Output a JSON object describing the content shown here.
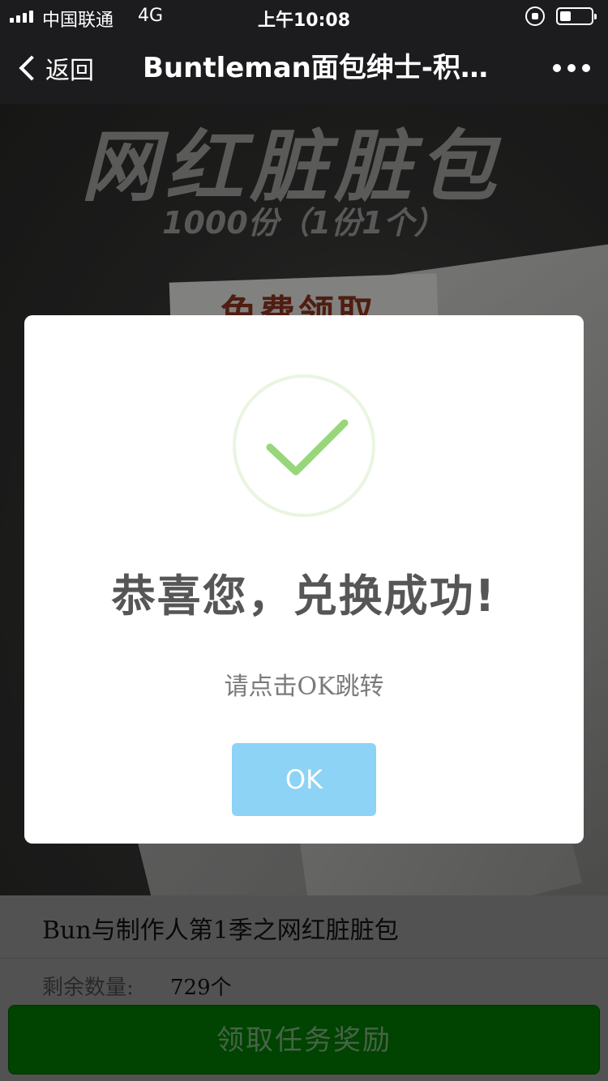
{
  "status_bar": {
    "carrier": "中国联通",
    "network": "4G",
    "time": "上午10:08",
    "battery_level": 0.35
  },
  "nav": {
    "back_label": "返回",
    "title": "Buntleman面包绅士-积…"
  },
  "banner": {
    "title": "网红脏脏包",
    "subtitle": "1000份（1份1个）",
    "tag": "免费领取"
  },
  "item": {
    "name": "Bun与制作人第1季之网红脏脏包",
    "remain_label": "剩余数量:",
    "remain_value": "729个"
  },
  "claim_button_label": "领取任务奖励",
  "modal": {
    "title": "恭喜您，兑换成功!",
    "text": "请点击OK跳转",
    "ok_label": "OK"
  },
  "colors": {
    "modal_ok_button": "#8dd3f5",
    "success_check": "#98d67a",
    "claim_button": "#036803"
  }
}
